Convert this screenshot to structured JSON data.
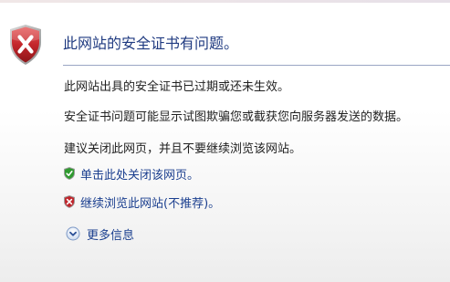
{
  "page": {
    "title": "此网站的安全证书有问题。",
    "paragraphs": [
      "此网站出具的安全证书已过期或还未生效。",
      "安全证书问题可能显示试图欺骗您或截获您向服务器发送的数据。",
      "建议关闭此网页，并且不要继续浏览该网站。"
    ],
    "actions": {
      "close": {
        "label": "单击此处关闭该网页。",
        "icon": "green-shield-check-icon"
      },
      "continue": {
        "label": "继续浏览此网站(不推荐)。",
        "icon": "red-shield-x-icon"
      }
    },
    "more_info": {
      "label": "更多信息",
      "icon": "chevron-down-circle-icon"
    },
    "main_icon": "red-shield-x-icon",
    "colors": {
      "title": "#1f3a80",
      "link": "#1b3f8f",
      "body_text": "#222222",
      "divider": "#9aa6c4",
      "danger": "#c0262c",
      "safe": "#2f9a2f"
    }
  }
}
